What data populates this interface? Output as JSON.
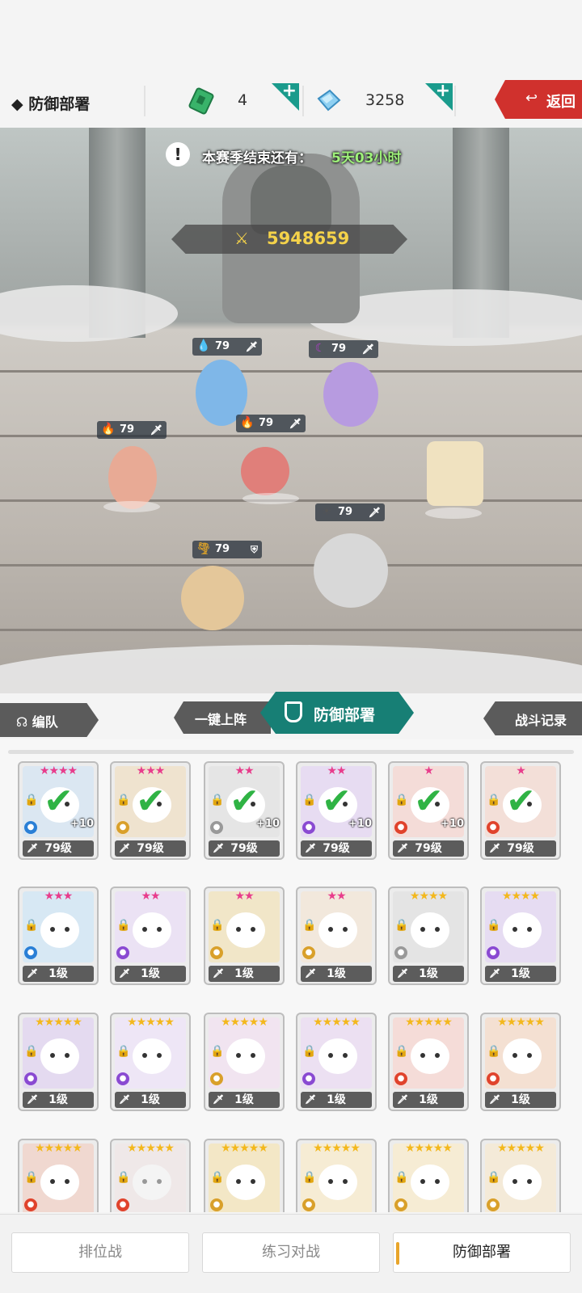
{
  "header": {
    "title": "◆ 防御部署",
    "ticket_count": "4",
    "gem_count": "3258",
    "back_label": "返回"
  },
  "scene": {
    "season_label": "本赛季结束还有：",
    "season_time": "5天03小时",
    "power": "5948659",
    "units": [
      {
        "level": "79",
        "element": "water"
      },
      {
        "level": "79",
        "element": "dark"
      },
      {
        "level": "79",
        "element": "fire"
      },
      {
        "level": "79",
        "element": "fire"
      },
      {
        "level": "79",
        "element": "light"
      },
      {
        "level": "79",
        "element": "wind"
      }
    ]
  },
  "tabs": {
    "team": "编队",
    "deploy_one": "一键上阵",
    "defense": "防御部署",
    "battle_log": "战斗记录"
  },
  "cards": [
    {
      "stars": "★★★★",
      "star_color": "#e83d8c",
      "level": "79级",
      "deployed": true,
      "plus": "+10",
      "element_color": "#2a7fd6",
      "bg": "#dbe7f2"
    },
    {
      "stars": "★★★",
      "star_color": "#e83d8c",
      "level": "79级",
      "deployed": true,
      "plus": "",
      "element_color": "#d9a02a",
      "bg": "#efe3cf"
    },
    {
      "stars": "★★",
      "star_color": "#e83d8c",
      "level": "79级",
      "deployed": true,
      "plus": "+10",
      "element_color": "#999999",
      "bg": "#e5e5e5"
    },
    {
      "stars": "★★",
      "star_color": "#e83d8c",
      "level": "79级",
      "deployed": true,
      "plus": "+10",
      "element_color": "#8a4ad2",
      "bg": "#e7dcf2"
    },
    {
      "stars": "★",
      "star_color": "#e83d8c",
      "level": "79级",
      "deployed": true,
      "plus": "+10",
      "element_color": "#e0432c",
      "bg": "#f4dcd8"
    },
    {
      "stars": "★",
      "star_color": "#e83d8c",
      "level": "79级",
      "deployed": true,
      "plus": "",
      "element_color": "#e0432c",
      "bg": "#f3dfd8"
    },
    {
      "stars": "★★★",
      "star_color": "#e83d8c",
      "level": "1级",
      "deployed": false,
      "plus": "",
      "element_color": "#2a7fd6",
      "bg": "#d7e8f4"
    },
    {
      "stars": "★★",
      "star_color": "#e83d8c",
      "level": "1级",
      "deployed": false,
      "plus": "",
      "element_color": "#8a4ad2",
      "bg": "#ebe2f4"
    },
    {
      "stars": "★★",
      "star_color": "#e83d8c",
      "level": "1级",
      "deployed": false,
      "plus": "",
      "element_color": "#d9a02a",
      "bg": "#f1e6c8"
    },
    {
      "stars": "★★",
      "star_color": "#e83d8c",
      "level": "1级",
      "deployed": false,
      "plus": "",
      "element_color": "#d9a02a",
      "bg": "#f2e8dc"
    },
    {
      "stars": "★★★★",
      "star_color": "#f3b81d",
      "level": "1级",
      "deployed": false,
      "plus": "",
      "element_color": "#999999",
      "bg": "#e4e4e4"
    },
    {
      "stars": "★★★★",
      "star_color": "#f3b81d",
      "level": "1级",
      "deployed": false,
      "plus": "",
      "element_color": "#8a4ad2",
      "bg": "#e6dcf2"
    },
    {
      "stars": "★★★★★",
      "star_color": "#f3b81d",
      "level": "1级",
      "deployed": false,
      "plus": "",
      "element_color": "#8a4ad2",
      "bg": "#e4daf0"
    },
    {
      "stars": "★★★★★",
      "star_color": "#f3b81d",
      "level": "1级",
      "deployed": false,
      "plus": "",
      "element_color": "#8a4ad2",
      "bg": "#eee6f6"
    },
    {
      "stars": "★★★★★",
      "star_color": "#f3b81d",
      "level": "1级",
      "deployed": false,
      "plus": "",
      "element_color": "#d9a02a",
      "bg": "#f1e4f0"
    },
    {
      "stars": "★★★★★",
      "star_color": "#f3b81d",
      "level": "1级",
      "deployed": false,
      "plus": "",
      "element_color": "#8a4ad2",
      "bg": "#ece0f2"
    },
    {
      "stars": "★★★★★",
      "star_color": "#f3b81d",
      "level": "1级",
      "deployed": false,
      "plus": "",
      "element_color": "#e0432c",
      "bg": "#f5dcd8"
    },
    {
      "stars": "★★★★★",
      "star_color": "#f3b81d",
      "level": "1级",
      "deployed": false,
      "plus": "",
      "element_color": "#e0432c",
      "bg": "#f4e0d2"
    },
    {
      "stars": "★★★★★",
      "star_color": "#f3b81d",
      "level": "",
      "deployed": false,
      "plus": "",
      "element_color": "#e0432c",
      "bg": "#f0d8d0"
    },
    {
      "stars": "★★★★★",
      "star_color": "#f3b81d",
      "level": "",
      "deployed": false,
      "plus": "",
      "element_color": "#e0432c",
      "bg": "#f4e4e4"
    },
    {
      "stars": "★★★★★",
      "star_color": "#f3b81d",
      "level": "",
      "deployed": false,
      "plus": "",
      "element_color": "#d9a02a",
      "bg": "#f3e7c6"
    },
    {
      "stars": "★★★★★",
      "star_color": "#f3b81d",
      "level": "",
      "deployed": false,
      "plus": "",
      "element_color": "#d9a02a",
      "bg": "#f6ecd4"
    },
    {
      "stars": "★★★★★",
      "star_color": "#f3b81d",
      "level": "",
      "deployed": false,
      "plus": "",
      "element_color": "#d9a02a",
      "bg": "#f6ecd4"
    },
    {
      "stars": "★★★★★",
      "star_color": "#f3b81d",
      "level": "",
      "deployed": false,
      "plus": "",
      "element_color": "#d9a02a",
      "bg": "#f4ead8"
    }
  ],
  "nav": {
    "ranked": "排位战",
    "practice": "练习对战",
    "defense": "防御部署"
  }
}
